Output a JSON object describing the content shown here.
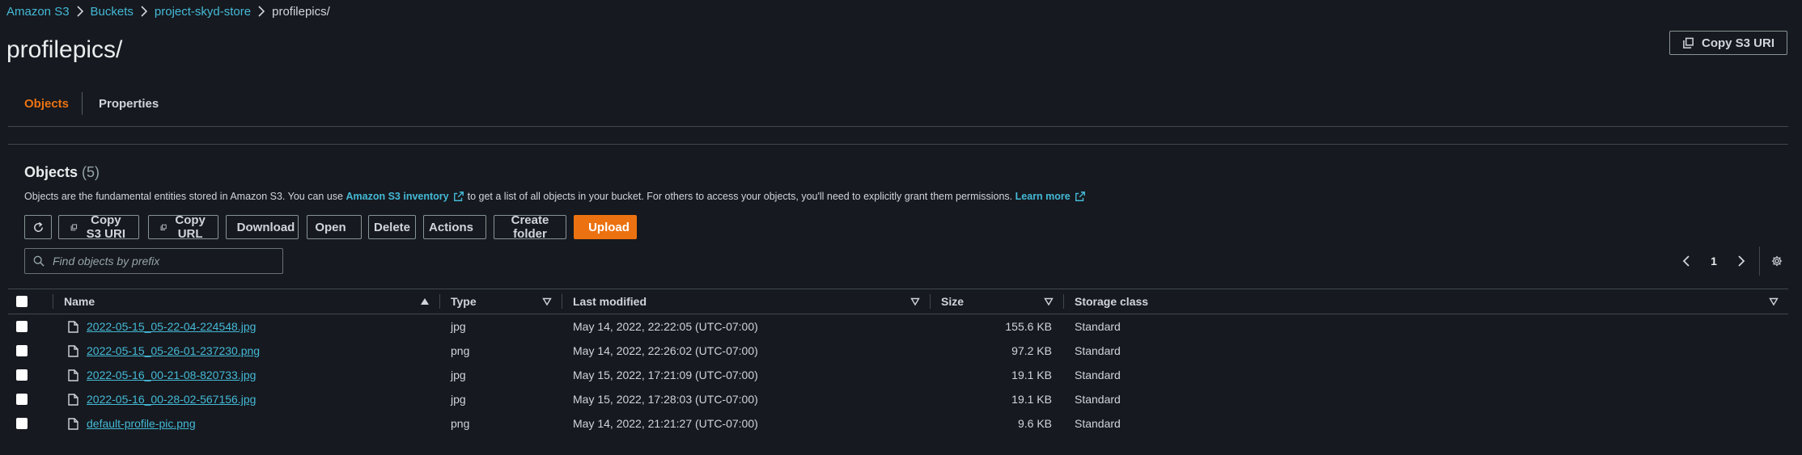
{
  "breadcrumb": [
    "Amazon S3",
    "Buckets",
    "project-skyd-store",
    "profilepics/"
  ],
  "page_title": "profilepics/",
  "copy_s3_uri_top": "Copy S3 URI",
  "tabs": [
    "Objects",
    "Properties"
  ],
  "objects_panel": {
    "title": "Objects",
    "count": "(5)",
    "description_pre": "Objects are the fundamental entities stored in Amazon S3. You can use",
    "inventory_link": "Amazon S3 inventory",
    "description_post": "to get a list of all objects in your bucket. For others to access your objects, you'll need to explicitly grant them permissions.",
    "learn_more": "Learn more"
  },
  "toolbar": {
    "copy_s3_uri": "Copy S3 URI",
    "copy_url": "Copy URL",
    "download": "Download",
    "open": "Open",
    "delete": "Delete",
    "actions": "Actions",
    "create_folder": "Create folder",
    "upload": "Upload"
  },
  "search": {
    "placeholder": "Find objects by prefix"
  },
  "pagination": {
    "page": "1"
  },
  "table": {
    "columns": [
      "Name",
      "Type",
      "Last modified",
      "Size",
      "Storage class"
    ],
    "rows": [
      {
        "name": "2022-05-15_05-22-04-224548.jpg",
        "type": "jpg",
        "modified": "May 14, 2022, 22:22:05 (UTC-07:00)",
        "size": "155.6 KB",
        "storage": "Standard"
      },
      {
        "name": "2022-05-15_05-26-01-237230.png",
        "type": "png",
        "modified": "May 14, 2022, 22:26:02 (UTC-07:00)",
        "size": "97.2 KB",
        "storage": "Standard"
      },
      {
        "name": "2022-05-16_00-21-08-820733.jpg",
        "type": "jpg",
        "modified": "May 15, 2022, 17:21:09 (UTC-07:00)",
        "size": "19.1 KB",
        "storage": "Standard"
      },
      {
        "name": "2022-05-16_00-28-02-567156.jpg",
        "type": "jpg",
        "modified": "May 15, 2022, 17:28:03 (UTC-07:00)",
        "size": "19.1 KB",
        "storage": "Standard"
      },
      {
        "name": "default-profile-pic.png",
        "type": "png",
        "modified": "May 14, 2022, 21:21:27 (UTC-07:00)",
        "size": "9.6 KB",
        "storage": "Standard"
      }
    ]
  },
  "colors": {
    "background": "#16191f",
    "accent": "#ec7211",
    "link": "#44b9d6",
    "border": "#414750"
  },
  "icons": [
    "chevron-right-icon",
    "copy-icon",
    "refresh-icon",
    "download-icon",
    "external-link-icon",
    "caret-down-icon",
    "upload-icon",
    "search-icon",
    "chevron-left-icon",
    "gear-icon",
    "sort-up-icon",
    "sort-down-icon",
    "file-icon"
  ]
}
